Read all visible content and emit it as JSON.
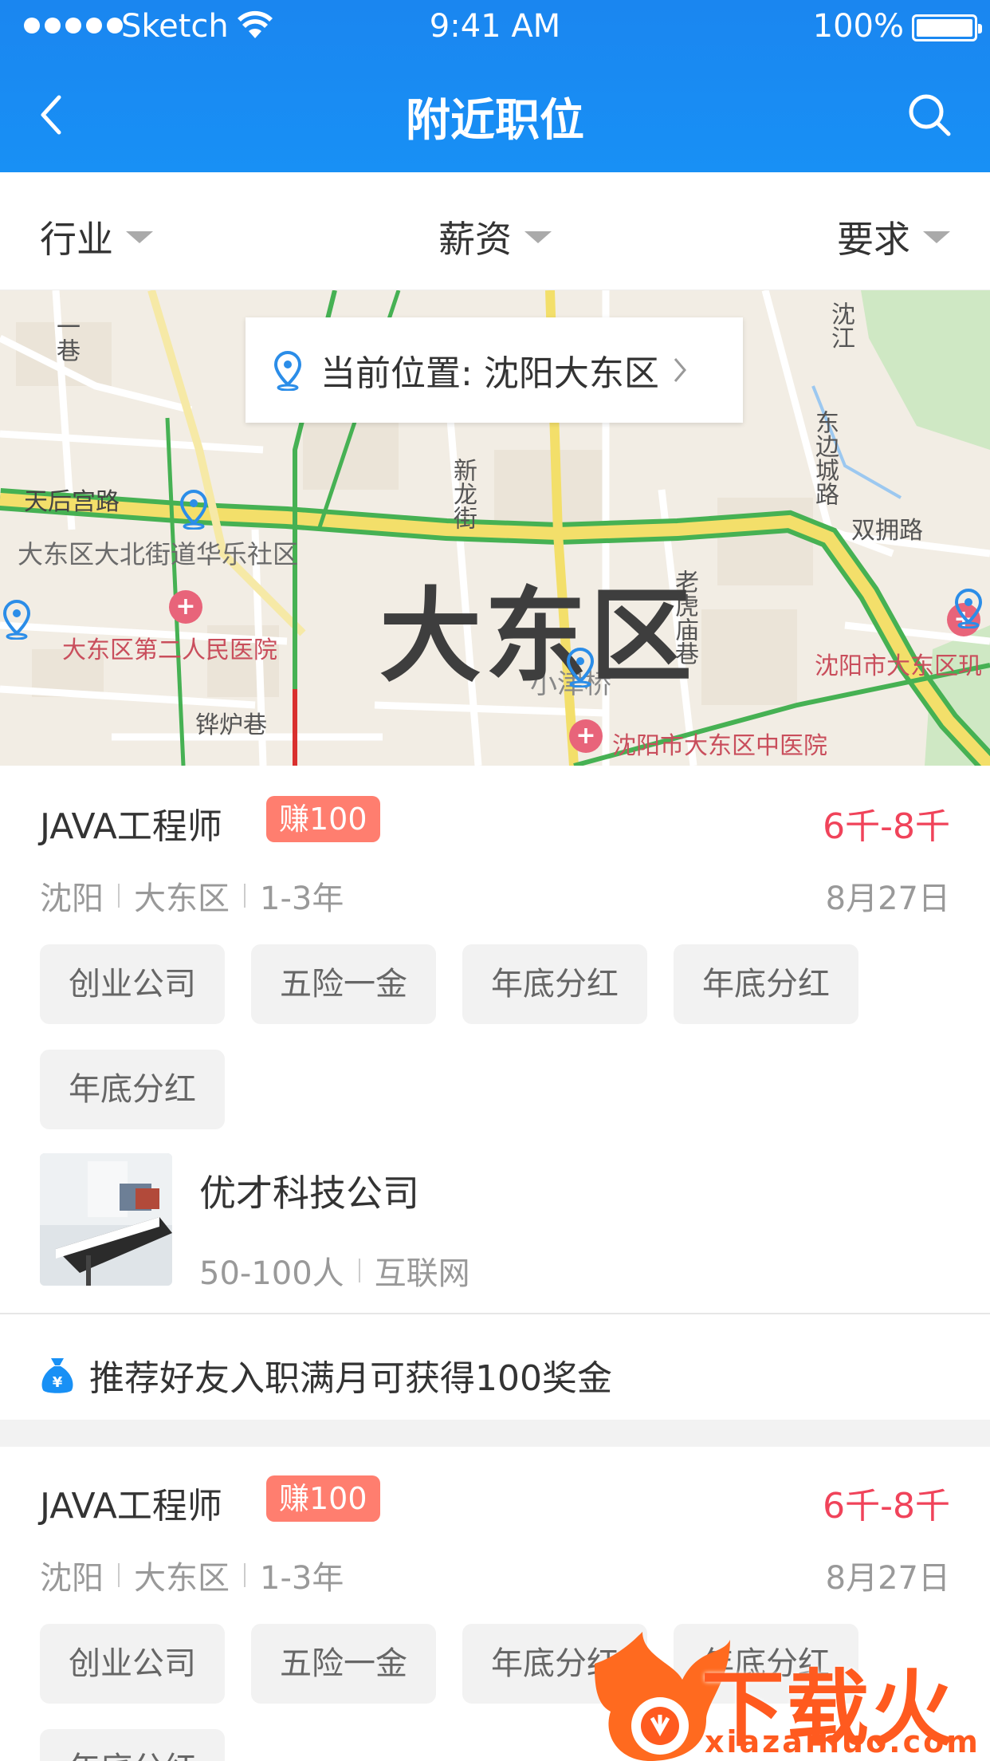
{
  "status_bar": {
    "carrier": "Sketch",
    "time": "9:41 AM",
    "battery": "100%"
  },
  "nav": {
    "title": "附近职位",
    "back_icon": "chevron-left-icon",
    "search_icon": "search-icon"
  },
  "filters": [
    {
      "label": "行业"
    },
    {
      "label": "薪资"
    },
    {
      "label": "要求"
    }
  ],
  "map": {
    "location_prefix": "当前位置:",
    "location": "沈阳大东区",
    "district": "大东区",
    "labels": {
      "tianhou": "天后宫路",
      "subdistrict": "大东区大北街道华乐社区",
      "hospital2": "大东区第二人民医院",
      "xiaojinqiao": "小津桥",
      "xinlongjie": "新龙街",
      "shuangyong": "双拥路",
      "dongbiancheng": "东边城路",
      "laohu": "老虎庙巷",
      "zhonghosp": "沈阳市大东区中医院",
      "dadongrim": "沈阳市大东区玑",
      "pulu": "铧炉巷",
      "yixiang": "一巷",
      "yuanjiang": "沈江"
    }
  },
  "jobs": [
    {
      "title": "JAVA工程师",
      "badge": "赚100",
      "salary": "6千-8千",
      "city": "沈阳",
      "district": "大东区",
      "experience": "1-3年",
      "date": "8月27日",
      "tags": [
        "创业公司",
        "五险一金",
        "年底分红",
        "年底分红",
        "年底分红"
      ],
      "company": {
        "name": "优才科技公司",
        "size": "50-100人",
        "industry": "互联网"
      },
      "referral": "推荐好友入职满月可获得100奖金"
    },
    {
      "title": "JAVA工程师",
      "badge": "赚100",
      "salary": "6千-8千",
      "city": "沈阳",
      "district": "大东区",
      "experience": "1-3年",
      "date": "8月27日",
      "tags": [
        "创业公司",
        "五险一金",
        "年底分红",
        "年底分红",
        "年底分红"
      ]
    }
  ],
  "watermark": {
    "text": "下载火",
    "url": "xiazaihuo.com"
  },
  "colors": {
    "header": "#1890f5",
    "salary": "#f0435a",
    "badge": "#ff7e6f"
  }
}
